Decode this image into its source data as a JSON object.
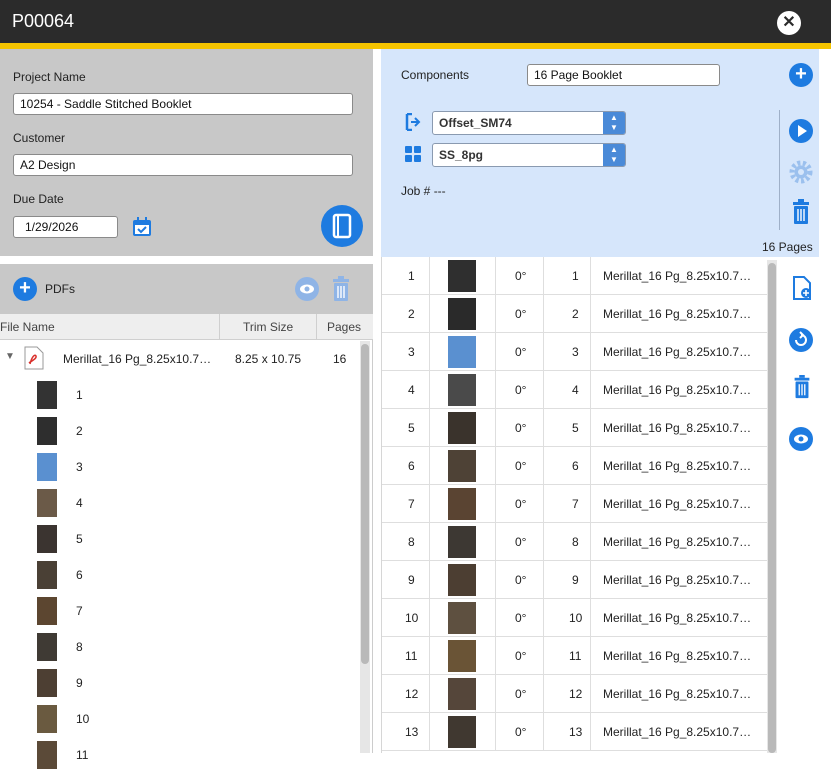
{
  "window": {
    "title": "P00064",
    "close_label": "✕"
  },
  "project": {
    "project_name_label": "Project Name",
    "project_name_value": "10254 - Saddle Stitched Booklet",
    "customer_label": "Customer",
    "customer_value": "A2 Design",
    "due_date_label": "Due Date",
    "due_date_value": "1/29/2026"
  },
  "pdfs": {
    "label": "PDFs",
    "columns": [
      "File Name",
      "Trim Size",
      "Pages"
    ],
    "file": {
      "name": "Merillat_16 Pg_8.25x10.7…",
      "trim": "8.25 x 10.75",
      "pages": "16"
    },
    "page_numbers": [
      "1",
      "2",
      "3",
      "4",
      "5",
      "6",
      "7",
      "8",
      "9",
      "10",
      "11"
    ]
  },
  "components": {
    "label": "Components",
    "value": "16 Page Booklet",
    "press_value": "Offset_SM74",
    "imposition_value": "SS_8pg",
    "job_label": "Job # ---",
    "page_count": "16 Pages"
  },
  "page_grid": {
    "rows": [
      {
        "n": "1",
        "rot": "0°",
        "page": "1",
        "file": "Merillat_16 Pg_8.25x10.7…"
      },
      {
        "n": "2",
        "rot": "0°",
        "page": "2",
        "file": "Merillat_16 Pg_8.25x10.7…"
      },
      {
        "n": "3",
        "rot": "0°",
        "page": "3",
        "file": "Merillat_16 Pg_8.25x10.7…"
      },
      {
        "n": "4",
        "rot": "0°",
        "page": "4",
        "file": "Merillat_16 Pg_8.25x10.7…"
      },
      {
        "n": "5",
        "rot": "0°",
        "page": "5",
        "file": "Merillat_16 Pg_8.25x10.7…"
      },
      {
        "n": "6",
        "rot": "0°",
        "page": "6",
        "file": "Merillat_16 Pg_8.25x10.7…"
      },
      {
        "n": "7",
        "rot": "0°",
        "page": "7",
        "file": "Merillat_16 Pg_8.25x10.7…"
      },
      {
        "n": "8",
        "rot": "0°",
        "page": "8",
        "file": "Merillat_16 Pg_8.25x10.7…"
      },
      {
        "n": "9",
        "rot": "0°",
        "page": "9",
        "file": "Merillat_16 Pg_8.25x10.7…"
      },
      {
        "n": "10",
        "rot": "0°",
        "page": "10",
        "file": "Merillat_16 Pg_8.25x10.7…"
      },
      {
        "n": "11",
        "rot": "0°",
        "page": "11",
        "file": "Merillat_16 Pg_8.25x10.7…"
      },
      {
        "n": "12",
        "rot": "0°",
        "page": "12",
        "file": "Merillat_16 Pg_8.25x10.7…"
      },
      {
        "n": "13",
        "rot": "0°",
        "page": "13",
        "file": "Merillat_16 Pg_8.25x10.7…"
      }
    ]
  },
  "icons": {
    "add": "plus-circle-icon",
    "view": "eye-icon",
    "delete": "trash-icon",
    "calendar": "calendar-check-icon",
    "booklet": "notebook-icon",
    "press": "press-output-icon",
    "imposition": "grid-icon",
    "play": "play-icon",
    "settings": "gear-icon",
    "add_page": "file-plus-icon",
    "rotate": "rotate-icon"
  },
  "colors": {
    "accent": "#1e7be0",
    "titlebar": "#2b2b2b",
    "stripe": "#f5c400",
    "panel_gray": "#c8c8c8",
    "panel_blue": "#d6e6fb"
  }
}
